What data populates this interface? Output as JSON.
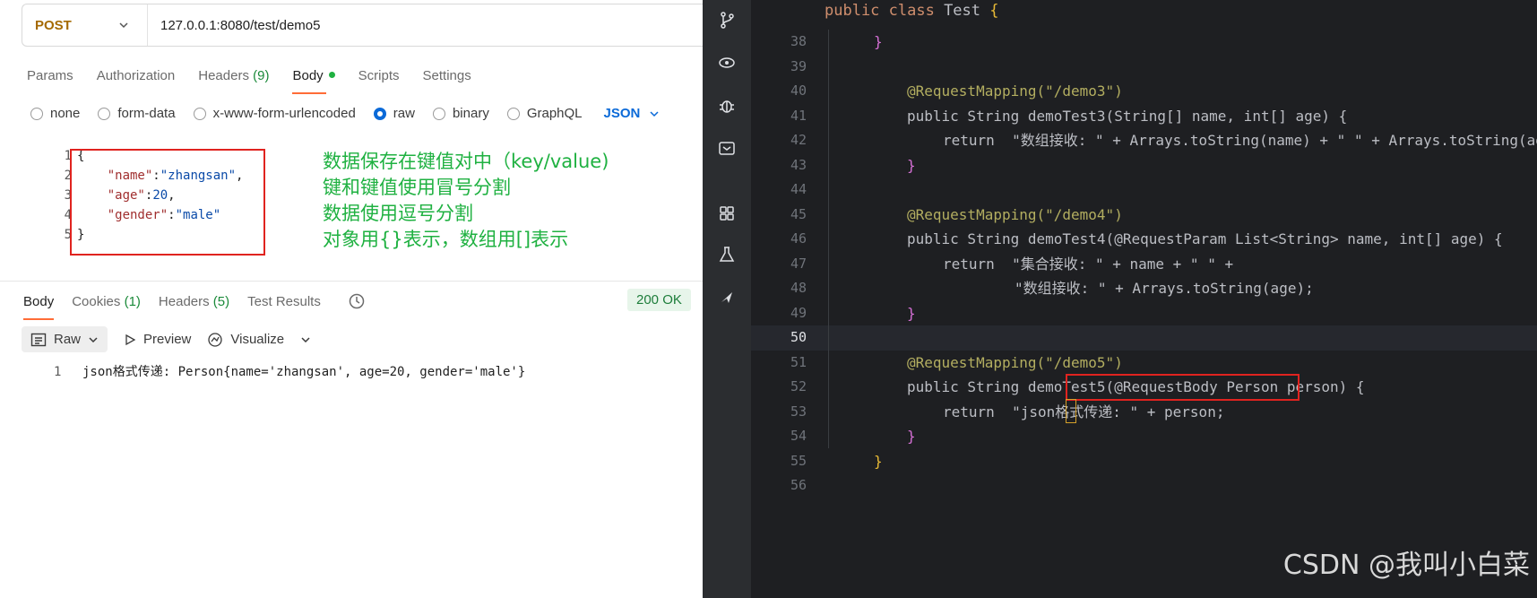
{
  "request": {
    "method": "POST",
    "url": "127.0.0.1:8080/test/demo5"
  },
  "request_tabs": [
    {
      "label": "Params"
    },
    {
      "label": "Authorization"
    },
    {
      "label": "Headers",
      "count": "(9)"
    },
    {
      "label": "Body"
    },
    {
      "label": "Scripts"
    },
    {
      "label": "Settings"
    }
  ],
  "body_types": {
    "none": "none",
    "form_data": "form-data",
    "urlencoded": "x-www-form-urlencoded",
    "raw": "raw",
    "binary": "binary",
    "graphql": "GraphQL",
    "format": "JSON"
  },
  "request_body": {
    "line_numbers": [
      "1",
      "2",
      "3",
      "4",
      "5"
    ],
    "l1": "{",
    "l2_key": "\"name\"",
    "l2_val": "\"zhangsan\"",
    "l3_key": "\"age\"",
    "l3_val": "20",
    "l4_key": "\"gender\"",
    "l4_val": "\"male\"",
    "l5": "}"
  },
  "annotations": [
    "数据保存在键值对中（key/value)",
    "键和键值使用冒号分割",
    "数据使用逗号分割",
    "对象用{}表示，数组用[]表示"
  ],
  "response_tabs": {
    "body": "Body",
    "cookies": "Cookies",
    "cookies_count": "(1)",
    "headers": "Headers",
    "headers_count": "(5)",
    "test_results": "Test Results"
  },
  "response_status": "200 OK",
  "view_bar": {
    "raw": "Raw",
    "preview": "Preview",
    "visualize": "Visualize"
  },
  "response_body": {
    "line_number": "1",
    "text": "json格式传递: Person{name='zhangsan', age=20, gender='male'}"
  },
  "ide": {
    "header": "public class Test {",
    "lines": [
      {
        "n": "38",
        "t": "}"
      },
      {
        "n": "39",
        "t": ""
      },
      {
        "n": "40",
        "t": "@RequestMapping(\"/demo3\")"
      },
      {
        "n": "41",
        "t": "public String demoTest3(String[] name, int[] age) {"
      },
      {
        "n": "42",
        "t": "return  \"数组接收: \" + Arrays.toString(name) + \" \" + Arrays.toString(age);"
      },
      {
        "n": "43",
        "t": "}"
      },
      {
        "n": "44",
        "t": ""
      },
      {
        "n": "45",
        "t": "@RequestMapping(\"/demo4\")"
      },
      {
        "n": "46",
        "t": "public String demoTest4(@RequestParam List<String> name, int[] age) {"
      },
      {
        "n": "47",
        "t": "return  \"集合接收: \" + name + \" \" +"
      },
      {
        "n": "48",
        "t": "\"数组接收: \" + Arrays.toString(age);"
      },
      {
        "n": "49",
        "t": "}"
      },
      {
        "n": "50",
        "t": ""
      },
      {
        "n": "51",
        "t": "@RequestMapping(\"/demo5\")"
      },
      {
        "n": "52",
        "t": "public String demoTest5(@RequestBody Person person) {"
      },
      {
        "n": "53",
        "t": "return  \"json格式传递: \" + person;"
      },
      {
        "n": "54",
        "t": "}"
      },
      {
        "n": "55",
        "t": "}"
      },
      {
        "n": "56",
        "t": ""
      }
    ]
  },
  "watermark": "CSDN @我叫小白菜"
}
